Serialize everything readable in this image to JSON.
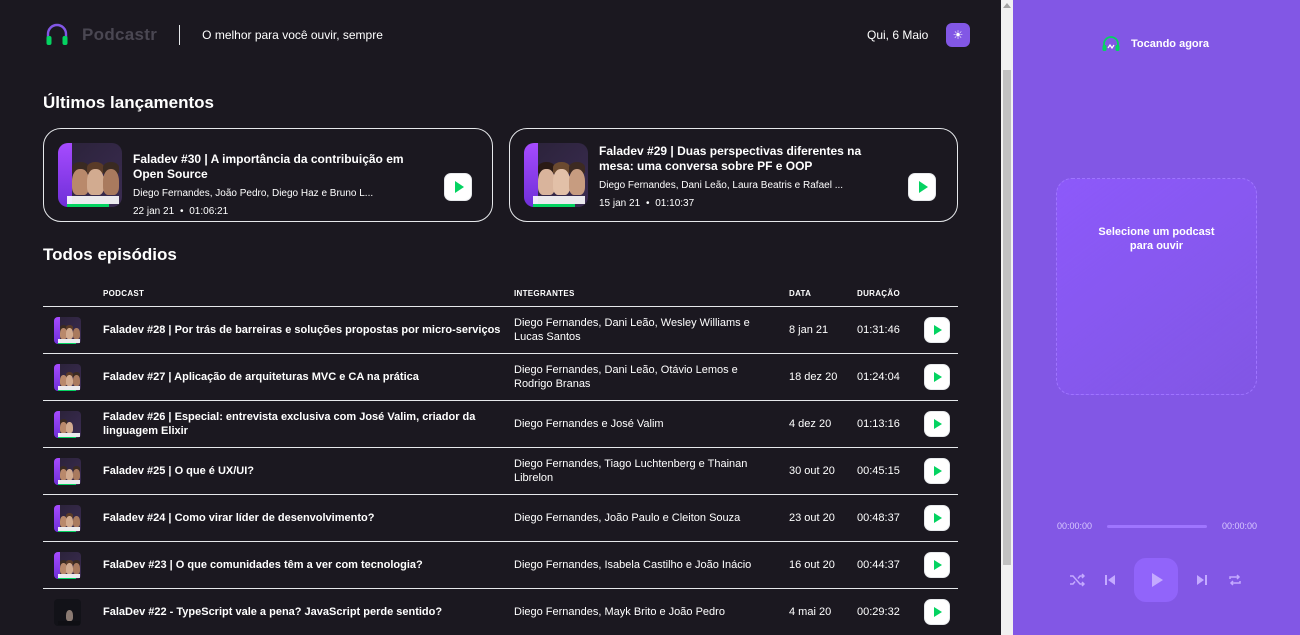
{
  "header": {
    "logo_text": "Podcastr",
    "tagline": "O melhor para você ouvir, sempre",
    "date": "Qui, 6 Maio",
    "theme_toggle_icon": "sun-icon"
  },
  "latest": {
    "title": "Últimos lançamentos",
    "items": [
      {
        "title": "Faladev #30 | A importância da contribuição em Open Source",
        "members": "Diego Fernandes, João Pedro, Diego Haz e Bruno L...",
        "date": "22 jan 21",
        "separator": "•",
        "duration": "01:06:21"
      },
      {
        "title": "Faladev #29 | Duas perspectivas diferentes na mesa: uma conversa sobre PF e OOP",
        "members": "Diego Fernandes, Dani Leão, Laura Beatris e Rafael ...",
        "date": "15 jan 21",
        "separator": "•",
        "duration": "01:10:37"
      }
    ]
  },
  "all": {
    "title": "Todos episódios",
    "columns": [
      "Podcast",
      "Integrantes",
      "Data",
      "Duração"
    ],
    "rows": [
      {
        "title": "Faladev #28 | Por trás de barreiras e soluções propostas por micro-serviços",
        "members": "Diego Fernandes, Dani Leão, Wesley Williams e Lucas Santos",
        "date": "8 jan 21",
        "duration": "01:31:46"
      },
      {
        "title": "Faladev #27 | Aplicação de arquiteturas MVC e CA na prática",
        "members": "Diego Fernandes, Dani Leão, Otávio Lemos e Rodrigo Branas",
        "date": "18 dez 20",
        "duration": "01:24:04"
      },
      {
        "title": "Faladev #26 | Especial: entrevista exclusiva com José Valim, criador da linguagem Elixir",
        "members": "Diego Fernandes e José Valim",
        "date": "4 dez 20",
        "duration": "01:13:16"
      },
      {
        "title": "Faladev #25 | O que é UX/UI?",
        "members": "Diego Fernandes, Tiago Luchtenberg e Thainan Librelon",
        "date": "30 out 20",
        "duration": "00:45:15"
      },
      {
        "title": "Faladev #24 | Como virar líder de desenvolvimento?",
        "members": "Diego Fernandes, João Paulo e Cleiton Souza",
        "date": "23 out 20",
        "duration": "00:48:37"
      },
      {
        "title": "FalaDev #23 | O que comunidades têm a ver com tecnologia?",
        "members": "Diego Fernandes, Isabela Castilho e João Inácio",
        "date": "16 out 20",
        "duration": "00:44:37"
      },
      {
        "title": "FalaDev #22 - TypeScript vale a pena? JavaScript perde sentido?",
        "members": "Diego Fernandes, Mayk Brito e João Pedro",
        "date": "4 mai 20",
        "duration": "00:29:32"
      }
    ]
  },
  "player": {
    "header": "Tocando agora",
    "empty_message": "Selecione um podcast para ouvir",
    "current_time": "00:00:00",
    "total_time": "00:00:00",
    "controls": [
      "shuffle-icon",
      "previous-icon",
      "play-icon",
      "next-icon",
      "repeat-icon"
    ]
  },
  "colors": {
    "background": "#1b1820",
    "accent": "#8257e5",
    "play_green": "#04d361",
    "border": "#e6e8eb"
  }
}
